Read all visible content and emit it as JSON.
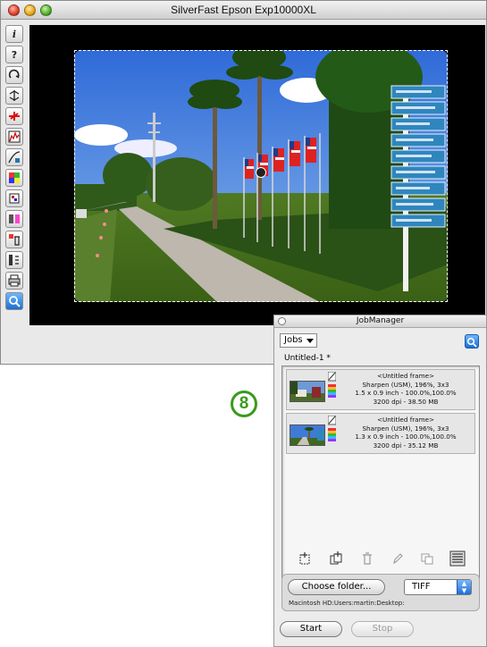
{
  "window": {
    "title": "SilverFast Epson Exp10000XL"
  },
  "toolbar": {
    "info_label": "i",
    "help_label": "?"
  },
  "step_badge": "8",
  "job_manager": {
    "title": "JobManager",
    "jobs_menu": "Jobs",
    "job_name": "Untitled-1 *",
    "jobs": [
      {
        "frame": "<Untitled frame>",
        "filter": "Sharpen (USM), 196%, 3x3",
        "size": "1.5 x 0.9 inch - 100.0%,100.0%",
        "resolution": "3200 dpi - 38.50 MB"
      },
      {
        "frame": "<Untitled frame>",
        "filter": "Sharpen (USM), 196%, 3x3",
        "size": "1.3 x 0.9 inch - 100.0%,100.0%",
        "resolution": "3200 dpi - 35.12 MB"
      }
    ],
    "choose_folder_label": "Choose folder...",
    "format": "TIFF",
    "destination": "Macintosh HD:Users:martin:Desktop:",
    "start_label": "Start",
    "stop_label": "Stop"
  }
}
